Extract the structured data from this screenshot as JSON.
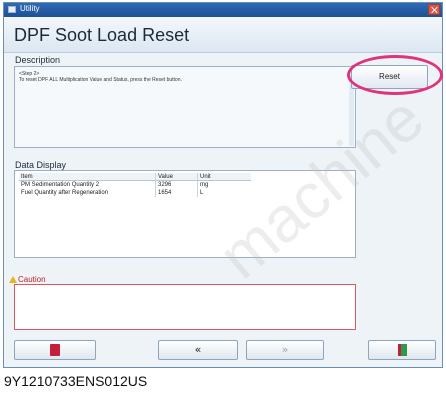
{
  "window": {
    "title": "Utility"
  },
  "header": {
    "title": "DPF Soot Load Reset"
  },
  "description": {
    "label": "Description",
    "step": "<Step 2>",
    "text": "To reset DPF ALL Multiplication Value and Status, press the Reset button."
  },
  "reset_button": {
    "label": "Reset"
  },
  "data_display": {
    "label": "Data Display",
    "columns": [
      "Item",
      "Value",
      "Unit"
    ],
    "rows": [
      [
        "PM Sedimentation Quantity 2",
        "3296",
        "mg"
      ],
      [
        "Fuel Quantity after Regeneration",
        "1654",
        "L"
      ]
    ]
  },
  "caution": {
    "label": "Caution"
  },
  "nav": {
    "prev": "«",
    "next": "»"
  },
  "watermark": "machine",
  "footer": {
    "code": "9Y1210733ENS012US"
  }
}
